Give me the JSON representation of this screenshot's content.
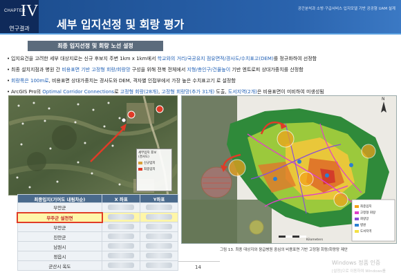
{
  "header": {
    "chapter_label": "CHAPTER",
    "chapter_number": "IV",
    "section": "연구결과",
    "title": "세부 입지선정 및 회랑 평가",
    "caption": "공간분석과 소방·구급서비스 입지모델 기반 공공형 UAM 설계"
  },
  "subtitle": "최종 입지선정 및 회랑 노선 설정",
  "bullets": [
    {
      "parts": [
        {
          "text": "입지요건을 고려한 세부 대상지로는 신규 후보지 주변 1km x 1km에서 ",
          "style": "plain"
        },
        {
          "text": "학교와의 거리/국공유지 점유면적/경사도/수치표고(DEM)",
          "style": "blue"
        },
        {
          "text": "를 정규화하여 선정함",
          "style": "plain"
        }
      ]
    },
    {
      "parts": [
        {
          "text": "최종 설치지점과 병원 간 ",
          "style": "plain"
        },
        {
          "text": "비용표면 기반 고정형 회랑/회랑망",
          "style": "blue"
        },
        {
          "text": " 구성을 위해 전북 전체에서 ",
          "style": "plain"
        },
        {
          "text": "지형/총인구/건물높이",
          "style": "blue"
        },
        {
          "text": " 기반 엔트로피 상대가중치를 산정함",
          "style": "plain"
        }
      ]
    },
    {
      "parts": [
        {
          "text": "회랑폭은 100m로",
          "style": "blue"
        },
        {
          "text": ", 비용표면 상대가중치는 경사도와 DEM, 격자별 인접부에서 가장 높은 수치표고기",
          "style": "plain"
        },
        {
          "text": "                    ",
          "style": "plain"
        },
        {
          "text": "로 설정함",
          "style": "plain"
        }
      ]
    },
    {
      "parts": [
        {
          "text": "ArcGIS Pro의 ",
          "style": "plain"
        },
        {
          "text": "Optimal Corridor Connections",
          "style": "blue"
        },
        {
          "text": "로 ",
          "style": "plain"
        },
        {
          "text": "고정형 회랑(28개)",
          "style": "blue"
        },
        {
          "text": ", ",
          "style": "plain"
        },
        {
          "text": "고정형 회랑망(추가 31개)",
          "style": "blue"
        },
        {
          "text": " 도출, ",
          "style": "plain"
        },
        {
          "text": "도서지역(2개)",
          "style": "blue"
        },
        {
          "text": "은 비용표면이 미비하여 미생성됨",
          "style": "plain"
        }
      ]
    }
  ],
  "map_legend_small": {
    "title": "세부입지 후보",
    "subtitle": "(경사도)",
    "items": [
      {
        "label": "신규입지",
        "color": "#d9a13a"
      },
      {
        "label": "최종입지",
        "color": "#e03b27"
      }
    ]
  },
  "table": {
    "headers": [
      "최종입지(기어도 내림차순)",
      "X 좌표",
      "Y좌표"
    ],
    "rows": [
      {
        "name": "부안군",
        "highlight": false
      },
      {
        "name": "무주군 설천면",
        "highlight": true
      },
      {
        "name": "부안군",
        "highlight": false
      },
      {
        "name": "진안군",
        "highlight": false
      },
      {
        "name": "남원시",
        "highlight": false
      },
      {
        "name": "정읍시",
        "highlight": false
      },
      {
        "name": "군산시 옥도",
        "highlight": false
      }
    ]
  },
  "map_right": {
    "legend_items": [
      {
        "label": "최종입지",
        "color": "#f4a21a"
      },
      {
        "label": "고정형 회랑",
        "color": "#e040c8"
      },
      {
        "label": "회랑망",
        "color": "#8a4fd6"
      },
      {
        "label": "병원",
        "color": "#2c7fd1"
      },
      {
        "label": "도서지역",
        "color": "#f3e043"
      }
    ],
    "scale_label": "Kilometers"
  },
  "map_caption": "그림 13. 최종 대상지와 응급병원 중심의 비용표면 기반 고정형 회랑/회랑망 제안",
  "page_number": "14",
  "watermark": {
    "title": "Windows 정품 인증",
    "subtitle": "[설정]으로 이동하여 Windows를"
  },
  "colors": {
    "header_dark": "#0f2a5a",
    "header_blue": "#1d4f91",
    "accent_blue": "#1f5fb5",
    "accent_red": "#c0262b",
    "highlight_row": "#fff6a8"
  }
}
